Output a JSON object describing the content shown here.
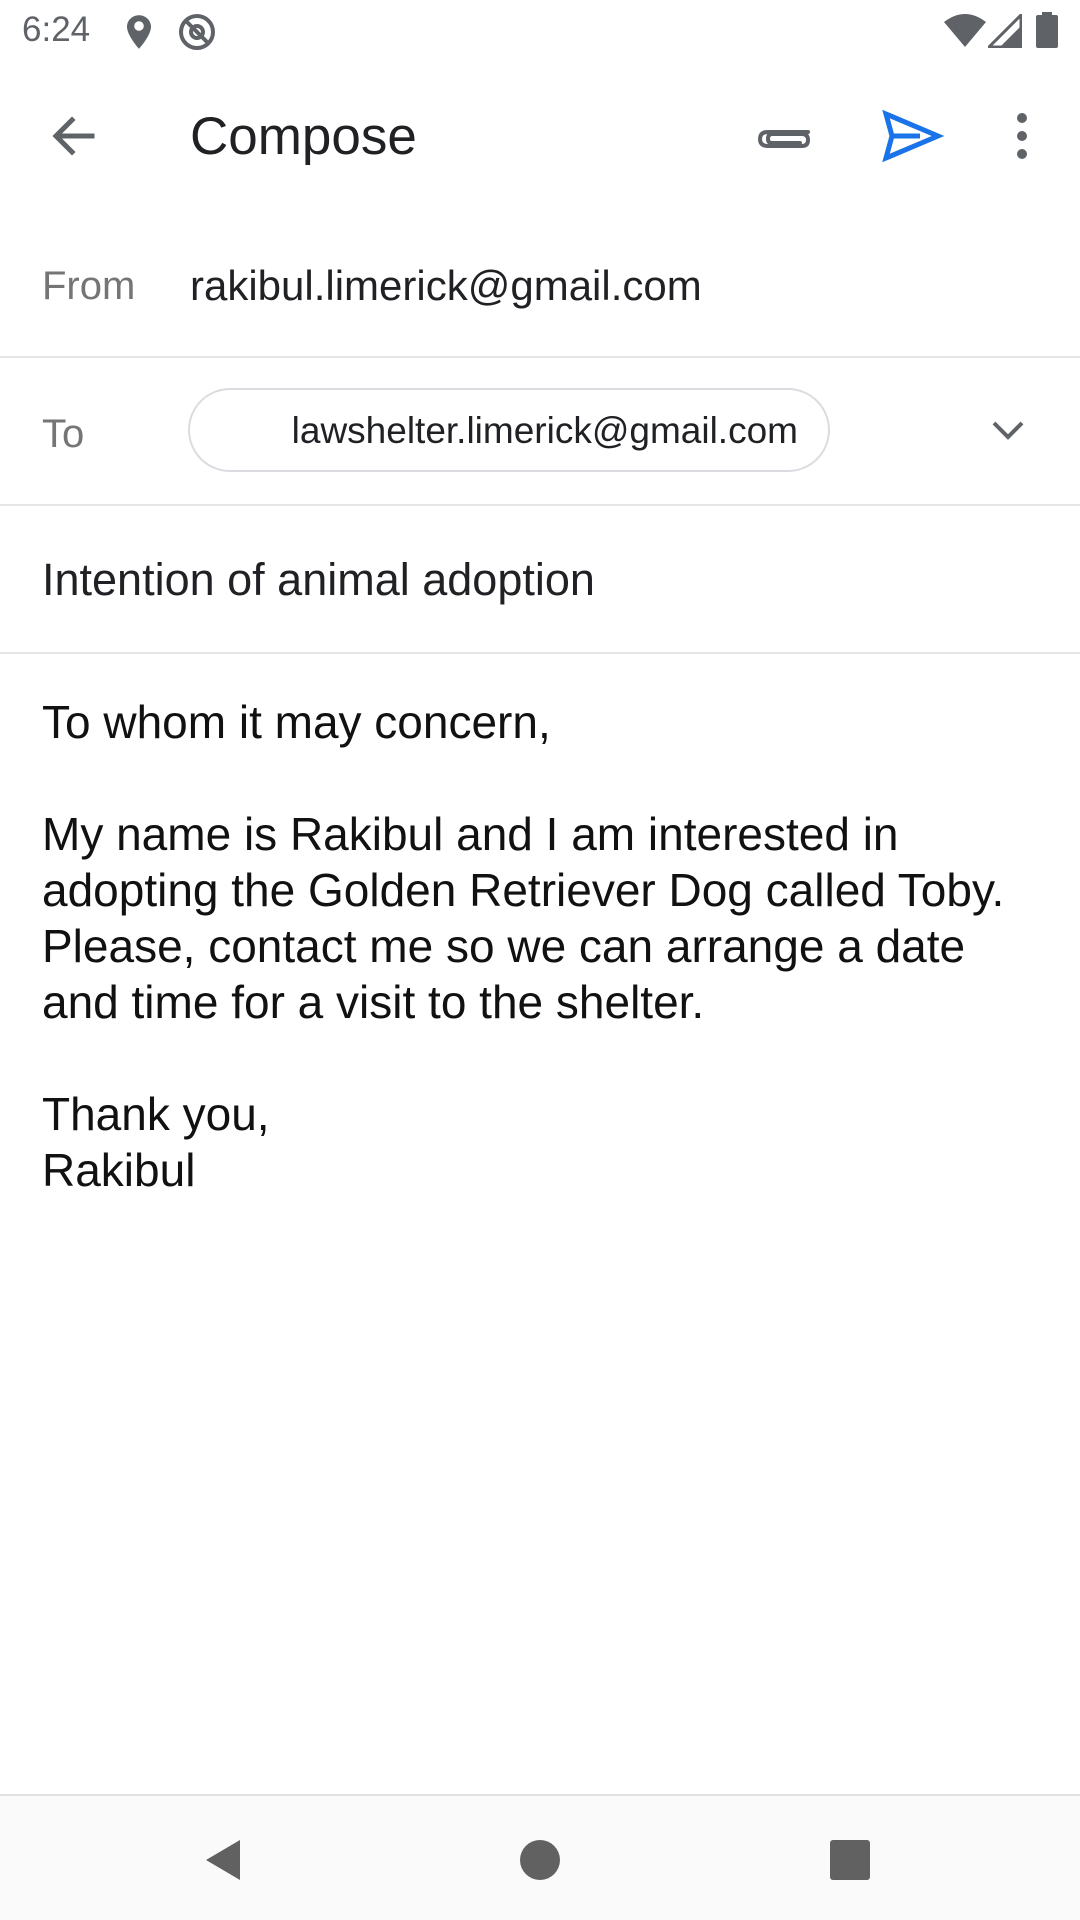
{
  "status_bar": {
    "time": "6:24",
    "icons": [
      "location-icon",
      "at-icon",
      "wifi-icon",
      "signal-icon",
      "battery-icon"
    ]
  },
  "app_bar": {
    "title": "Compose",
    "actions": [
      "attach-icon",
      "send-icon",
      "more-vert-icon"
    ],
    "accent_color": "#1a73e8"
  },
  "from": {
    "label": "From",
    "value": "rakibul.limerick@gmail.com"
  },
  "to": {
    "label": "To",
    "recipient": "lawshelter.limerick@gmail.com"
  },
  "subject": {
    "value": "Intention of animal adoption"
  },
  "body": {
    "text": "To whom it may concern,\n\nMy name is Rakibul and I am interested in adopting the Golden Retriever Dog called Toby. Please, contact me so we can arrange a date and time for a visit to the shelter.\n\nThank you,\nRakibul"
  },
  "nav_bar": {
    "buttons": [
      "back-nav-icon",
      "home-nav-icon",
      "recents-nav-icon"
    ]
  }
}
